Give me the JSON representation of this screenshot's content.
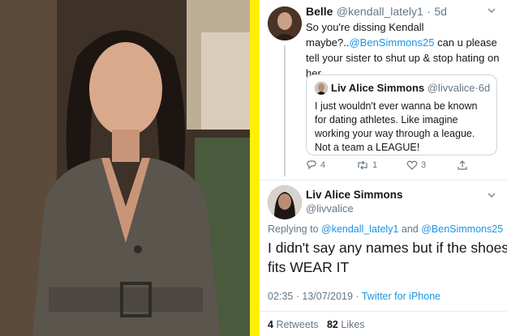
{
  "colors": {
    "accent_yellow": "#ffef00",
    "link_blue": "#1b95e0",
    "muted_gray": "#657786"
  },
  "photo": {
    "subject": ""
  },
  "reply_tweet": {
    "author_name": "Belle",
    "author_handle": "@kendall_lately1",
    "time_sep": "·",
    "time": "5d",
    "text_lines": [
      "So you're dissing Kendall",
      "maybe?..",
      " can u please",
      "tell your sister to shut up & stop hating on",
      "her."
    ],
    "mention": "@BenSimmons25"
  },
  "quoted_tweet": {
    "author_name": "Liv Alice Simmons",
    "author_handle": "@livvalice",
    "time_sep": "·",
    "time": "6d",
    "text_lines": [
      "I just wouldn't ever wanna be known",
      "for dating athletes. Like imagine",
      "working your way through a league.",
      "Not a team a LEAGUE!"
    ]
  },
  "reply_actions": {
    "reply_count": "4",
    "retweet_count": "1",
    "like_count": "3"
  },
  "main_tweet": {
    "author_name": "Liv Alice Simmons",
    "author_handle": "@livvalice",
    "replying_prefix": "Replying to ",
    "replying_user1": "@kendall_lately1",
    "replying_and": " and ",
    "replying_user2": "@BenSimmons25",
    "text_line1": "I didn't say any names but if the shoes",
    "text_line2": "fits WEAR IT",
    "timestamp": "02:35 · 13/07/2019 · ",
    "source": "Twitter for iPhone",
    "retweets_count": "4",
    "retweets_label": "Retweets",
    "likes_count": "82",
    "likes_label": "Likes"
  }
}
